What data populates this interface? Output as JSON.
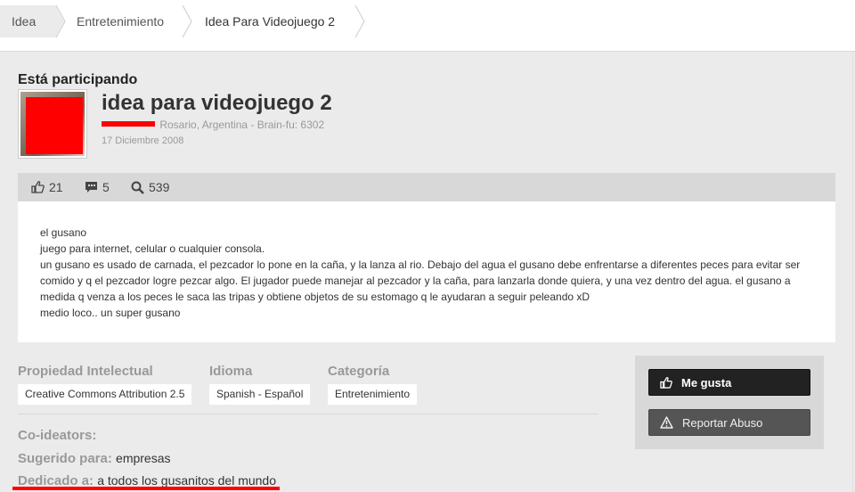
{
  "breadcrumb": {
    "items": [
      "Idea",
      "Entretenimiento",
      "Idea Para Videojuego 2"
    ]
  },
  "post": {
    "status": "Está participando",
    "title": "idea para videojuego 2",
    "author_location": "Rosario, Argentina - Brain-fu: 6302",
    "date": "17 Diciembre 2008"
  },
  "stats": {
    "likes": "21",
    "comments": "5",
    "views": "539"
  },
  "content": {
    "lines": [
      "el gusano",
      "juego para internet, celular o cualquier consola.",
      "un gusano es usado de carnada, el pezcador lo pone en la caña, y la lanza al rio. Debajo del agua el gusano debe enfrentarse a diferentes peces para evitar ser comido y q el pezcador logre pezcar algo. El jugador puede manejar al pezcador y la caña, para lanzarla donde quiera, y una vez dentro del agua. el gusano a medida q venza a los peces le saca las tripas y obtiene objetos de su estomago q le ayudaran a seguir peleando xD",
      "medio loco.. un super gusano"
    ]
  },
  "meta": {
    "ip_label": "Propiedad Intelectual",
    "ip_value": "Creative Commons Attribution 2.5",
    "lang_label": "Idioma",
    "lang_value": "Spanish - Español",
    "cat_label": "Categoría",
    "cat_value": "Entretenimiento",
    "coideators_label": "Co-ideators:",
    "suggested_label": "Sugerido para:",
    "suggested_value": "empresas",
    "dedicated_label": "Dedicado a:",
    "dedicated_value": "a todos los gusanitos del mundo"
  },
  "actions": {
    "like_label": "Me gusta",
    "report_label": "Reportar Abuso"
  },
  "colors": {
    "accent_redact": "#ff0000",
    "like_button": "#222222",
    "report_button": "#555555"
  }
}
